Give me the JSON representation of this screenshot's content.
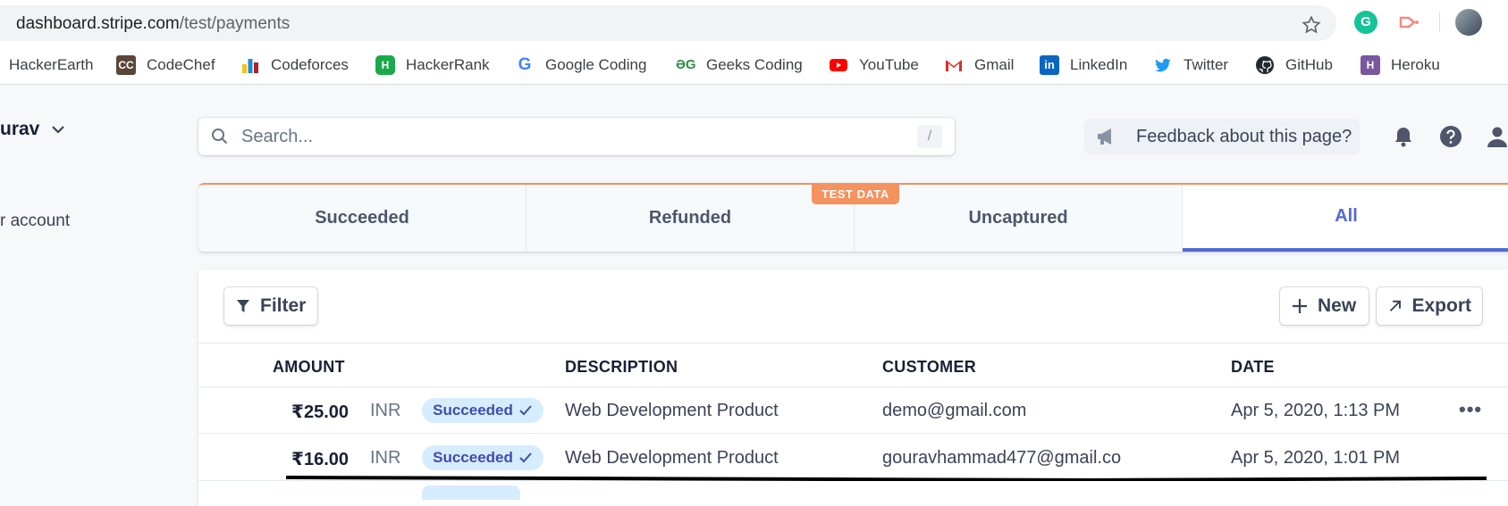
{
  "browser": {
    "url_domain": "dashboard.stripe.com",
    "url_path": "/test/payments",
    "bookmarks": [
      {
        "label": "HackerEarth",
        "icon": "hackerearth-icon"
      },
      {
        "label": "CodeChef",
        "icon": "codechef-icon"
      },
      {
        "label": "Codeforces",
        "icon": "codeforces-icon"
      },
      {
        "label": "HackerRank",
        "icon": "hackerrank-icon"
      },
      {
        "label": "Google Coding",
        "icon": "google-icon"
      },
      {
        "label": "Geeks Coding",
        "icon": "geeksforgeeks-icon"
      },
      {
        "label": "YouTube",
        "icon": "youtube-icon"
      },
      {
        "label": "Gmail",
        "icon": "gmail-icon"
      },
      {
        "label": "LinkedIn",
        "icon": "linkedin-icon"
      },
      {
        "label": "Twitter",
        "icon": "twitter-icon"
      },
      {
        "label": "GitHub",
        "icon": "github-icon"
      },
      {
        "label": "Heroku",
        "icon": "heroku-icon"
      }
    ]
  },
  "sidebar": {
    "account_name": "urav",
    "link": "r account"
  },
  "header": {
    "search_placeholder": "Search...",
    "search_shortcut": "/",
    "feedback_label": "Feedback about this page?"
  },
  "tabs": {
    "items": [
      "Succeeded",
      "Refunded",
      "Uncaptured",
      "All"
    ],
    "active": "All",
    "test_badge": "TEST DATA"
  },
  "toolbar": {
    "filter_label": "Filter",
    "new_label": "New",
    "export_label": "Export"
  },
  "table": {
    "columns": {
      "amount": "AMOUNT",
      "description": "DESCRIPTION",
      "customer": "CUSTOMER",
      "date": "DATE"
    },
    "rows": [
      {
        "amount": "₹25.00",
        "currency": "INR",
        "status": "Succeeded",
        "description": "Web Development Product",
        "customer": "demo@gmail.com",
        "date": "Apr 5, 2020, 1:13 PM",
        "more": "•••"
      },
      {
        "amount": "₹16.00",
        "currency": "INR",
        "status": "Succeeded",
        "description": "Web Development Product",
        "customer": "gouravhammad477@gmail.co",
        "date": "Apr 5, 2020, 1:01 PM",
        "more": ""
      }
    ]
  },
  "colors": {
    "accent": "#5469d4",
    "test_mode": "#f5925e",
    "badge_bg": "#d6ecff",
    "badge_text": "#3d4eac"
  }
}
